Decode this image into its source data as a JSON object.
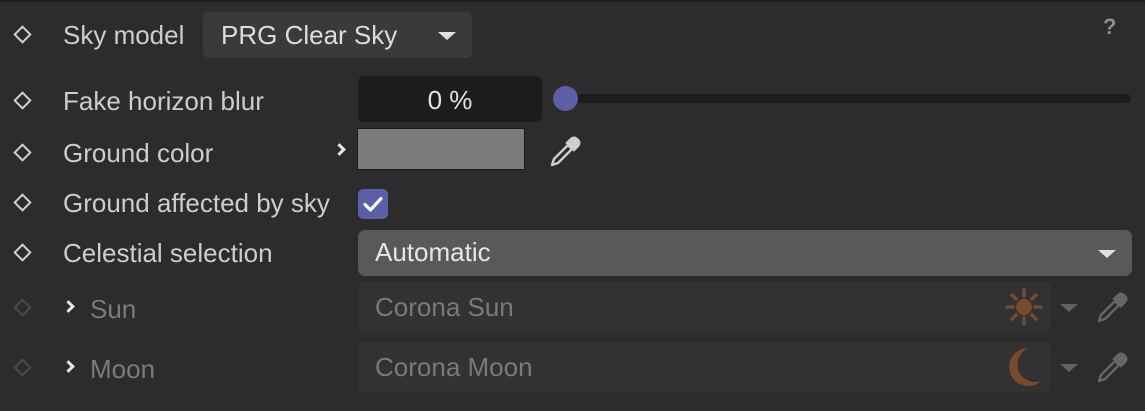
{
  "panel": {
    "help_label": "?",
    "sky_model": {
      "label": "Sky model",
      "value": "PRG Clear Sky"
    },
    "fake_horizon_blur": {
      "label": "Fake horizon blur",
      "value": "0 %",
      "slider_fraction": 0.0
    },
    "ground_color": {
      "label": "Ground color",
      "swatch_color": "#7b7b7b"
    },
    "ground_affected_by_sky": {
      "label": "Ground affected by sky",
      "checked": true
    },
    "celestial_selection": {
      "label": "Celestial selection",
      "value": "Automatic"
    },
    "sun": {
      "label": "Sun",
      "value": "Corona Sun",
      "icon": "sun-icon"
    },
    "moon": {
      "label": "Moon",
      "value": "Corona Moon",
      "icon": "moon-icon"
    }
  },
  "colors": {
    "background": "#2c2c2c",
    "accent": "#5d5fa6",
    "celestial_icon": "#7a4a30"
  }
}
